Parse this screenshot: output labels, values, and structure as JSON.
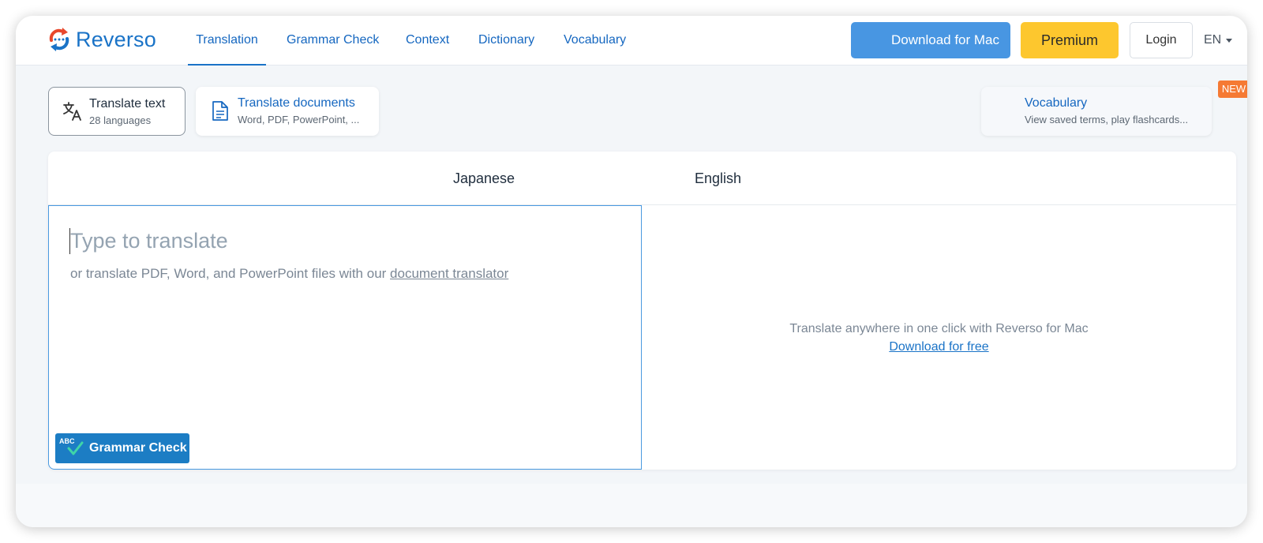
{
  "header": {
    "logo_text": "Reverso",
    "nav": [
      {
        "label": "Translation",
        "active": true
      },
      {
        "label": "Grammar Check"
      },
      {
        "label": "Context"
      },
      {
        "label": "Dictionary"
      },
      {
        "label": "Vocabulary"
      }
    ],
    "download_mac_label": "Download for Mac",
    "premium_label": "Premium",
    "login_label": "Login",
    "language": "EN"
  },
  "modes": {
    "translate_text": {
      "title": "Translate text",
      "subtitle": "28 languages"
    },
    "translate_documents": {
      "title": "Translate documents",
      "subtitle": "Word, PDF, PowerPoint, ..."
    },
    "vocabulary": {
      "title": "Vocabulary",
      "subtitle": "View saved terms, play flashcards...",
      "badge": "NEW"
    }
  },
  "translator": {
    "source_language": "Japanese",
    "target_language": "English",
    "input_value": "",
    "input_placeholder": "Type to translate",
    "hint_prefix": "or translate PDF, Word, and PowerPoint files with our ",
    "hint_link": "document translator",
    "grammar_check_abc": "ABC",
    "grammar_check_label": "Grammar Check",
    "promo_text": "Translate anywhere in one click with Reverso for Mac",
    "promo_link": "Download for free"
  },
  "colors": {
    "brand_blue": "#1a73c7",
    "download_button": "#4896e2",
    "premium_button": "#fdc72e",
    "new_badge": "#f57a34",
    "grammar_button": "#1c7dc4",
    "logo_red": "#e8472b"
  }
}
